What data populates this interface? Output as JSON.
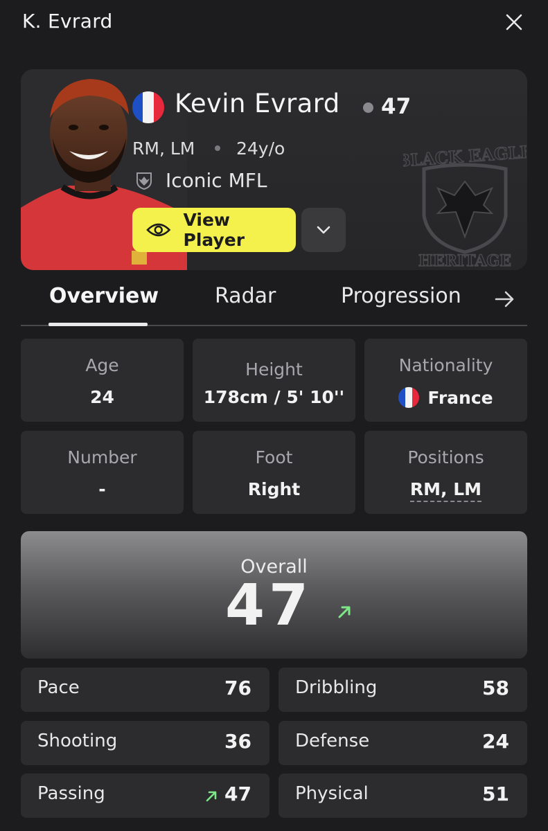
{
  "header": {
    "title": "K. Evrard"
  },
  "player": {
    "name": "Kevin Evrard",
    "rating": "47",
    "positions": "RM, LM",
    "age_label": "24y/o",
    "club": "Iconic MFL",
    "view_button": "View Player"
  },
  "tabs": [
    {
      "label": "Overview",
      "active": true
    },
    {
      "label": "Radar",
      "active": false
    },
    {
      "label": "Progression",
      "active": false
    }
  ],
  "info": {
    "age": {
      "label": "Age",
      "value": "24"
    },
    "height": {
      "label": "Height",
      "value": "178cm / 5' 10''"
    },
    "nationality": {
      "label": "Nationality",
      "value": "France"
    },
    "number": {
      "label": "Number",
      "value": "-"
    },
    "foot": {
      "label": "Foot",
      "value": "Right"
    },
    "positions": {
      "label": "Positions",
      "value": "RM, LM"
    }
  },
  "overall": {
    "label": "Overall",
    "value": "47",
    "trend": "up"
  },
  "stats": {
    "pace": {
      "label": "Pace",
      "value": "76"
    },
    "dribbling": {
      "label": "Dribbling",
      "value": "58"
    },
    "shooting": {
      "label": "Shooting",
      "value": "36"
    },
    "defense": {
      "label": "Defense",
      "value": "24"
    },
    "passing": {
      "label": "Passing",
      "value": "47",
      "trend": "up"
    },
    "physical": {
      "label": "Physical",
      "value": "51"
    }
  },
  "colors": {
    "background": "#1c1c1e",
    "card": "#2c2c2e",
    "accent_yellow": "#f4f14d",
    "trend_green": "#7ee787",
    "flag_blue": "#1f4fc4",
    "flag_red": "#e8283c"
  },
  "icons": [
    "close-icon",
    "eye-icon",
    "chevron-down-icon",
    "arrow-right-icon",
    "trend-up-icon",
    "club-crest-icon",
    "france-flag-icon"
  ]
}
